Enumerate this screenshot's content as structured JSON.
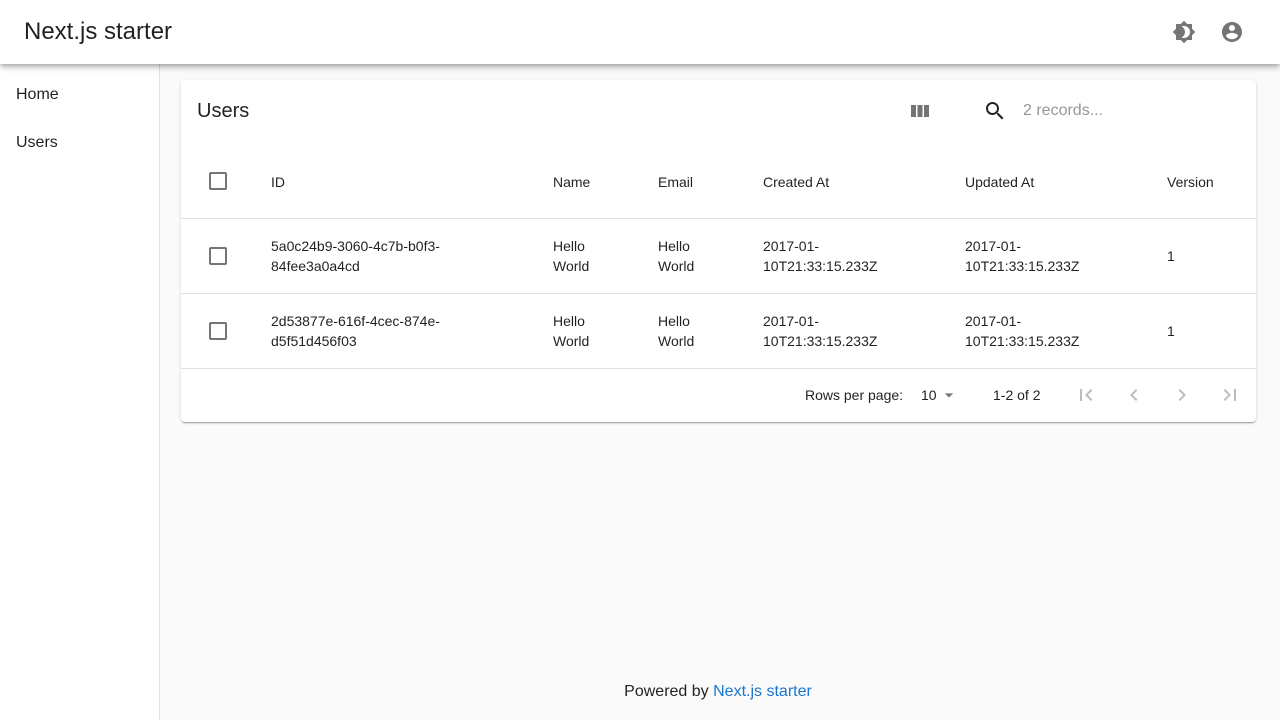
{
  "app": {
    "title": "Next.js starter"
  },
  "header": {
    "theme_icon": "brightness-icon",
    "account_icon": "account-circle-icon"
  },
  "sidebar": {
    "items": [
      {
        "label": "Home"
      },
      {
        "label": "Users"
      }
    ]
  },
  "table": {
    "title": "Users",
    "columns_icon": "view-column-icon",
    "search_icon": "search-icon",
    "search_placeholder": "2 records...",
    "headers": [
      "ID",
      "Name",
      "Email",
      "Created At",
      "Updated At",
      "Version"
    ],
    "rows": [
      {
        "id": "5a0c24b9-3060-4c7b-b0f3-\n84fee3a0a4cd",
        "name": "Hello\nWorld",
        "email": "Hello\nWorld",
        "created_at": "2017-01-\n10T21:33:15.233Z",
        "updated_at": "2017-01-\n10T21:33:15.233Z",
        "version": "1"
      },
      {
        "id": "2d53877e-616f-4cec-874e-\nd5f51d456f03",
        "name": "Hello\nWorld",
        "email": "Hello\nWorld",
        "created_at": "2017-01-\n10T21:33:15.233Z",
        "updated_at": "2017-01-\n10T21:33:15.233Z",
        "version": "1"
      }
    ]
  },
  "pagination": {
    "rows_per_page_label": "Rows per page:",
    "rows_per_page_value": "10",
    "range_label": "1-2 of 2"
  },
  "footer": {
    "prefix": "Powered by",
    "link_text": "Next.js starter",
    "link_color": "#1976d2"
  }
}
